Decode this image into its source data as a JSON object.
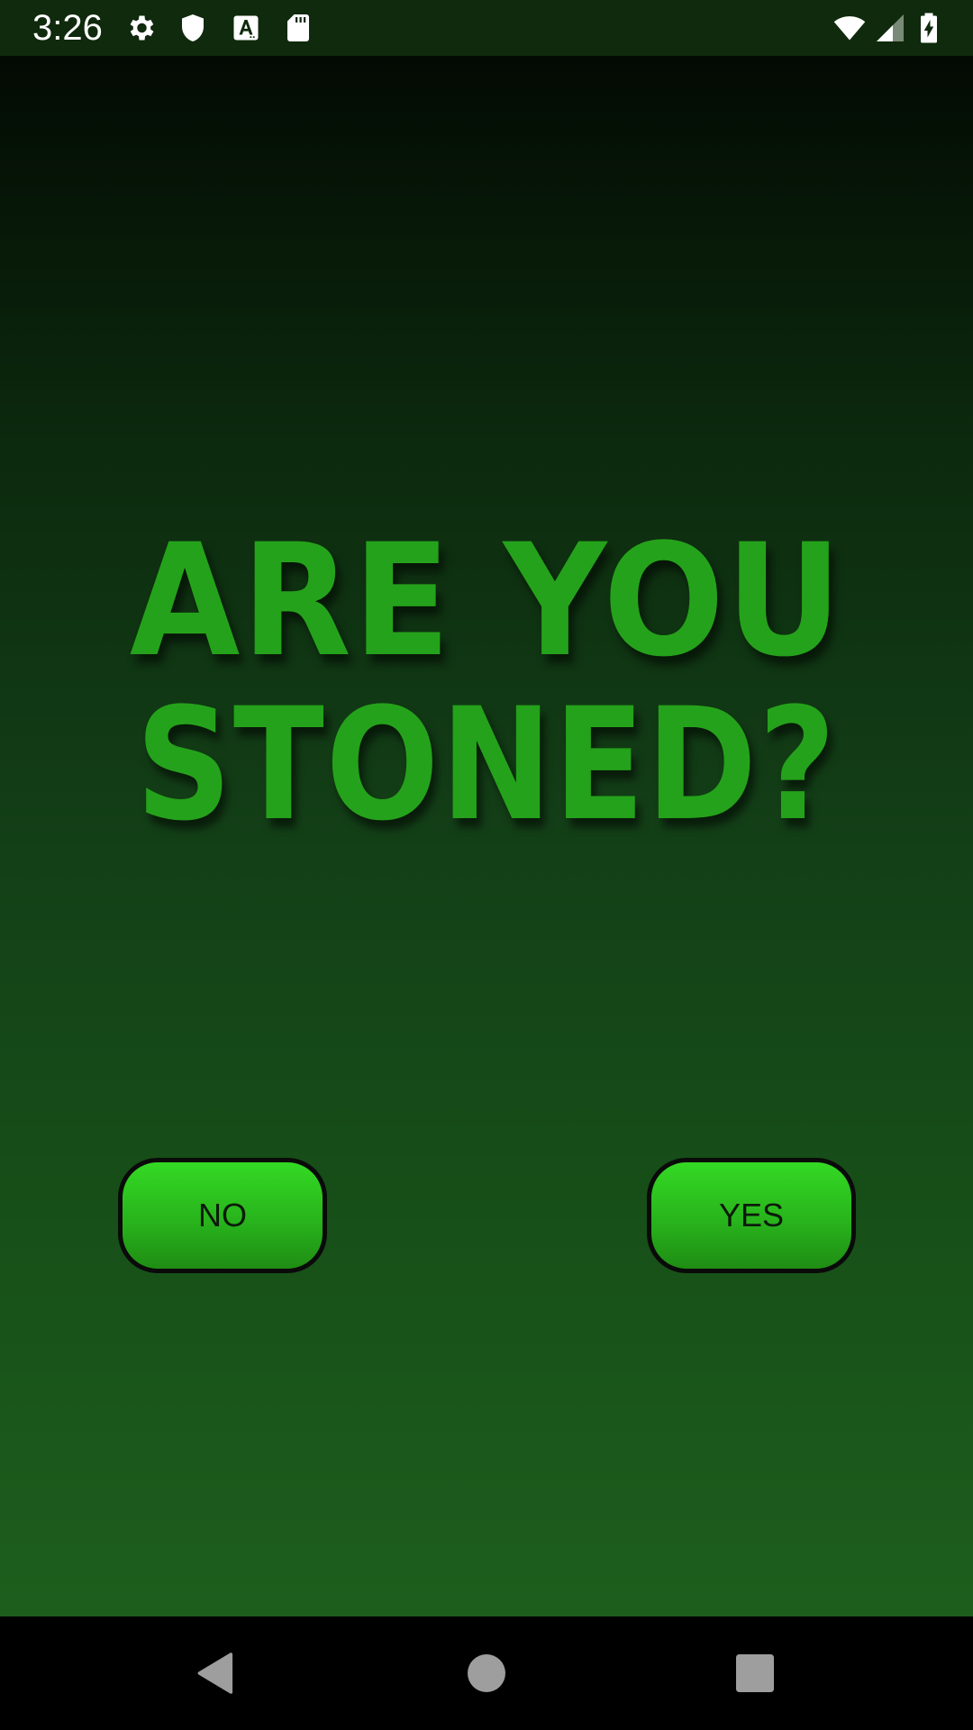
{
  "status_bar": {
    "time": "3:26",
    "icons": [
      "gear-icon",
      "shield-icon",
      "text-a-icon",
      "sd-card-icon",
      "wifi-icon",
      "signal-icon",
      "battery-charging-icon"
    ]
  },
  "headline": {
    "line1": "ARE YOU",
    "line2": "STONED?"
  },
  "buttons": {
    "no_label": "NO",
    "yes_label": "YES"
  },
  "nav_bar": {
    "icons": [
      "back-icon",
      "home-icon",
      "recents-icon"
    ]
  },
  "colors": {
    "status_bar_bg": "#0f2a0c",
    "headline_green": "#25a21b",
    "button_green": "#28b41c",
    "background_top": "#030a03",
    "background_bottom": "#1d5e1d"
  }
}
